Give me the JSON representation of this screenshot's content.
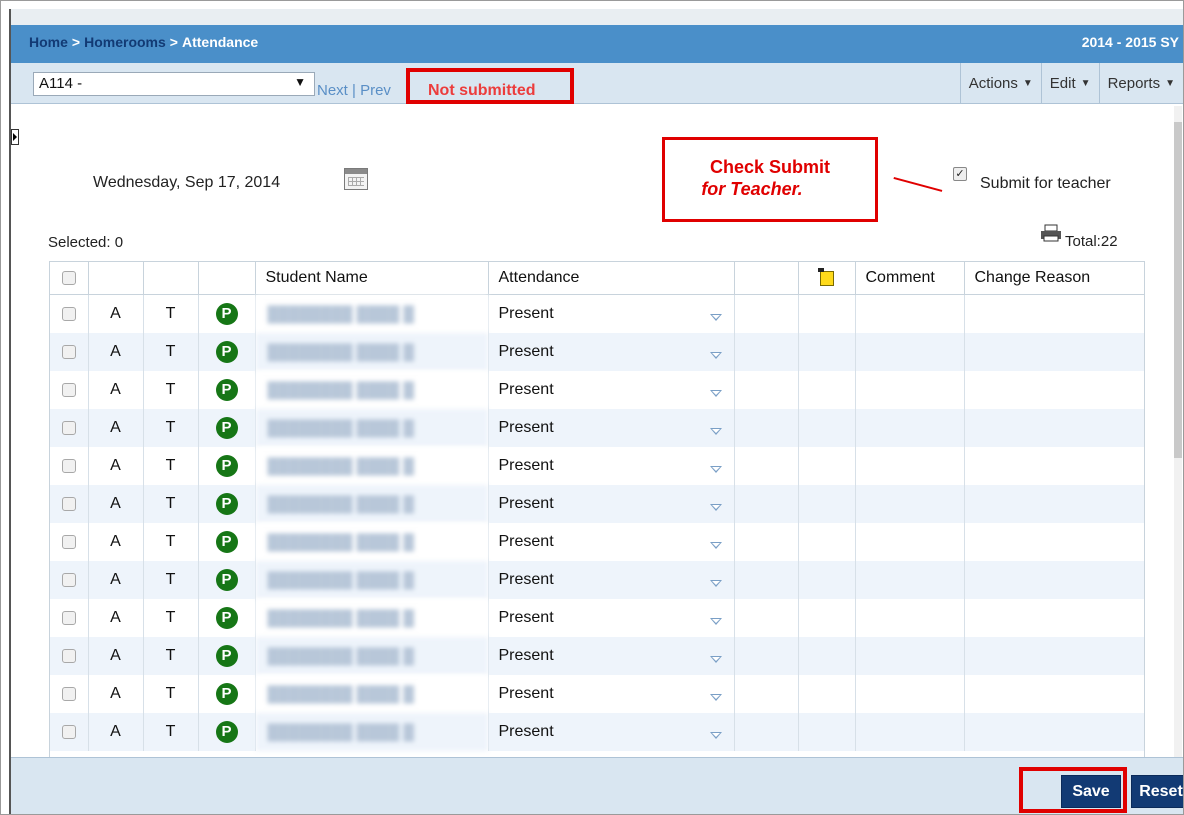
{
  "breadcrumb": {
    "items": [
      "Home",
      "Homerooms",
      "Attendance"
    ],
    "separator": ">"
  },
  "school_year": "2014 - 2015 SY",
  "toolbar": {
    "homeroom_value": "A114 -",
    "next_link": "Next",
    "prev_link": "Prev",
    "status": "Not submitted",
    "menus": [
      "Actions",
      "Edit",
      "Reports"
    ]
  },
  "date_display": "Wednesday, Sep 17, 2014",
  "callout": {
    "line1": "Check Submit",
    "line2": "for Teacher."
  },
  "submit_for_teacher": {
    "label": "Submit for teacher",
    "checked": true
  },
  "selected_count": "Selected: 0",
  "total_count": "Total:22",
  "table": {
    "headers": [
      "",
      "",
      "",
      "",
      "Student Name",
      "Attendance",
      "",
      "",
      "Comment",
      "Change Reason"
    ],
    "rows": [
      {
        "a": "A",
        "t": "T",
        "p": "P",
        "attendance": "Present"
      },
      {
        "a": "A",
        "t": "T",
        "p": "P",
        "attendance": "Present"
      },
      {
        "a": "A",
        "t": "T",
        "p": "P",
        "attendance": "Present"
      },
      {
        "a": "A",
        "t": "T",
        "p": "P",
        "attendance": "Present"
      },
      {
        "a": "A",
        "t": "T",
        "p": "P",
        "attendance": "Present"
      },
      {
        "a": "A",
        "t": "T",
        "p": "P",
        "attendance": "Present"
      },
      {
        "a": "A",
        "t": "T",
        "p": "P",
        "attendance": "Present"
      },
      {
        "a": "A",
        "t": "T",
        "p": "P",
        "attendance": "Present"
      },
      {
        "a": "A",
        "t": "T",
        "p": "P",
        "attendance": "Present"
      },
      {
        "a": "A",
        "t": "T",
        "p": "P",
        "attendance": "Present"
      },
      {
        "a": "A",
        "t": "T",
        "p": "P",
        "attendance": "Present"
      },
      {
        "a": "A",
        "t": "T",
        "p": "P",
        "attendance": "Present"
      }
    ]
  },
  "footer": {
    "save_label": "Save",
    "reset_label": "Reset"
  },
  "icons": {
    "calendar": "calendar-icon",
    "printer": "printer-icon",
    "note": "note-icon",
    "dropdown": "dropdown-arrow-icon"
  },
  "colors": {
    "header_blue": "#4a8fc9",
    "toolbar_light": "#d9e6f1",
    "button_navy": "#123a74",
    "status_red": "#ec3c3c",
    "present_green": "#167616",
    "highlight_red": "#e00000"
  }
}
